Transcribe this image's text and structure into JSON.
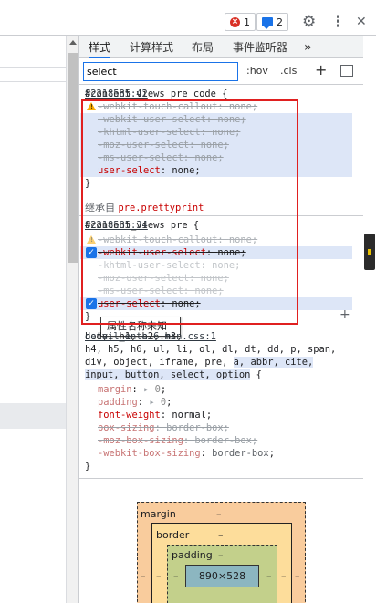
{
  "topbar": {
    "errors_count": "1",
    "messages_count": "2",
    "settings_icon": "gear-icon",
    "more_icon": "kebab-icon",
    "close_icon": "close-icon",
    "more_glyph": "⋮",
    "close_glyph": "✕",
    "settings_glyph": "⚙"
  },
  "tabs": [
    {
      "label": "样式",
      "active": true
    },
    {
      "label": "计算样式"
    },
    {
      "label": "布局"
    },
    {
      "label": "事件监听器"
    },
    {
      "label": "»"
    }
  ],
  "filter": {
    "value": "select",
    "hov": ":hov",
    "cls": ".cls",
    "add": "+"
  },
  "rule1": {
    "selector": "#content_views pre code {",
    "source": "82218585:42",
    "lines": [
      {
        "prop": "-webkit-touch-callout",
        "val": "none",
        "struck": true,
        "warn": true
      },
      {
        "prop": "-webkit-user-select",
        "val": "none",
        "struck": true
      },
      {
        "prop": "-khtml-user-select",
        "val": "none",
        "struck": true
      },
      {
        "prop": "-moz-user-select",
        "val": "none",
        "struck": true
      },
      {
        "prop": "-ms-user-select",
        "val": "none",
        "struck": true
      },
      {
        "prop": "user-select",
        "val": "none"
      }
    ],
    "close": "}"
  },
  "inherited": {
    "label": "继承自",
    "selector": "pre.prettyprint"
  },
  "rule2": {
    "selector": "#content_views pre {",
    "source": "82218585:34",
    "lines": [
      {
        "prop": "-webkit-touch-callout",
        "val": "none"
      },
      {
        "prop": "-webkit-user-select",
        "val": "none"
      },
      {
        "prop": "-khtml-user-select",
        "val": "none"
      },
      {
        "prop": "-moz-user-select",
        "val": "none"
      },
      {
        "prop": "-ms-user-select",
        "val": "none"
      },
      {
        "prop": "user-select",
        "val": "none"
      }
    ],
    "tooltip": "属性名称未知",
    "close": "}"
  },
  "rule3": {
    "selector_l1": "body, h1, h2, h3,",
    "source": "detail_ente…6.min.css:1",
    "selector_l2": "h4, h5, h6, ul, li, ol, dl, dt, dd, p, span,",
    "selector_l3": "div, object, iframe, pre,",
    "selector_l3_match": "a, abbr, cite,",
    "selector_l4_match": "input, button, select, option",
    "selector_l4_end": " {",
    "lines": [
      {
        "prop": "margin",
        "val": "0",
        "arrow": true
      },
      {
        "prop": "padding",
        "val": "0",
        "arrow": true
      },
      {
        "prop": "font-weight",
        "val": "normal"
      },
      {
        "prop": "box-sizing",
        "val": "border-box",
        "struck": true
      },
      {
        "prop": "-moz-box-sizing",
        "val": "border-box",
        "struck": true
      },
      {
        "prop": "-webkit-box-sizing",
        "val": "border-box"
      }
    ],
    "close": "}"
  },
  "boxmodel": {
    "margin_label": "margin",
    "margin_val": "–",
    "border_label": "border",
    "border_val": "–",
    "padding_label": "padding",
    "padding_val": "–",
    "content": "890×528",
    "side": "–"
  }
}
